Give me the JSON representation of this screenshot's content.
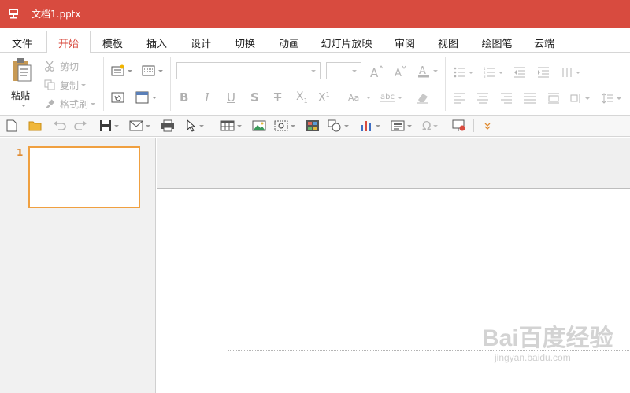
{
  "window": {
    "title": "文档1.pptx"
  },
  "menu": {
    "tabs": [
      {
        "label": "文件"
      },
      {
        "label": "开始"
      },
      {
        "label": "模板"
      },
      {
        "label": "插入"
      },
      {
        "label": "设计"
      },
      {
        "label": "切换"
      },
      {
        "label": "动画"
      },
      {
        "label": "幻灯片放映"
      },
      {
        "label": "审阅"
      },
      {
        "label": "视图"
      },
      {
        "label": "绘图笔"
      },
      {
        "label": "云端"
      }
    ],
    "active": "开始"
  },
  "ribbon": {
    "paste_label": "粘贴",
    "cut_label": "剪切",
    "copy_label": "复制",
    "format_painter_label": "格式刷",
    "font_name": "",
    "font_size": ""
  },
  "slides": {
    "items": [
      {
        "number": "1"
      }
    ]
  },
  "watermark": {
    "text": "Bai百度经验",
    "sub": "jingyan.baidu.com"
  },
  "colors": {
    "titlebar": "#d84b3f",
    "accent": "#d84b3f",
    "slide_selected": "#f0a040"
  }
}
